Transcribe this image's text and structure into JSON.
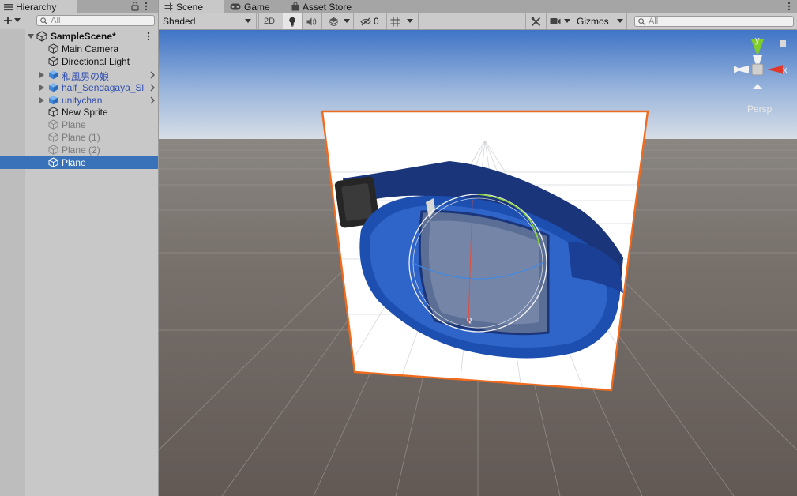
{
  "hierarchy": {
    "tab_label": "Hierarchy",
    "search_placeholder": "All",
    "items": [
      {
        "label": "SampleScene*",
        "kind": "scene"
      },
      {
        "label": "Main Camera",
        "kind": "object"
      },
      {
        "label": "Directional Light",
        "kind": "object"
      },
      {
        "label": "和風男の娘",
        "kind": "prefab"
      },
      {
        "label": "half_Sendagaya_Sl",
        "kind": "prefab"
      },
      {
        "label": "unitychan",
        "kind": "prefab"
      },
      {
        "label": "New Sprite",
        "kind": "object"
      },
      {
        "label": "Plane",
        "kind": "disabled"
      },
      {
        "label": "Plane (1)",
        "kind": "disabled"
      },
      {
        "label": "Plane (2)",
        "kind": "disabled"
      },
      {
        "label": "Plane",
        "kind": "selected"
      }
    ]
  },
  "tabs": {
    "scene": "Scene",
    "game": "Game",
    "asset_store": "Asset Store"
  },
  "toolbar": {
    "draw_mode": "Shaded",
    "mode_2d": "2D",
    "hidden_count": "0",
    "gizmos": "Gizmos",
    "search_placeholder": "All"
  },
  "viewport": {
    "projection": "Persp",
    "axis_y": "y",
    "axis_x": "x"
  },
  "colors": {
    "selection": "#3a72b9",
    "prefab_text": "#2e4db1",
    "outline": "#f26b1d",
    "axis_x": "#e0392b",
    "axis_y": "#7fcc2a",
    "pouch_blue": "#1d4fb0"
  }
}
